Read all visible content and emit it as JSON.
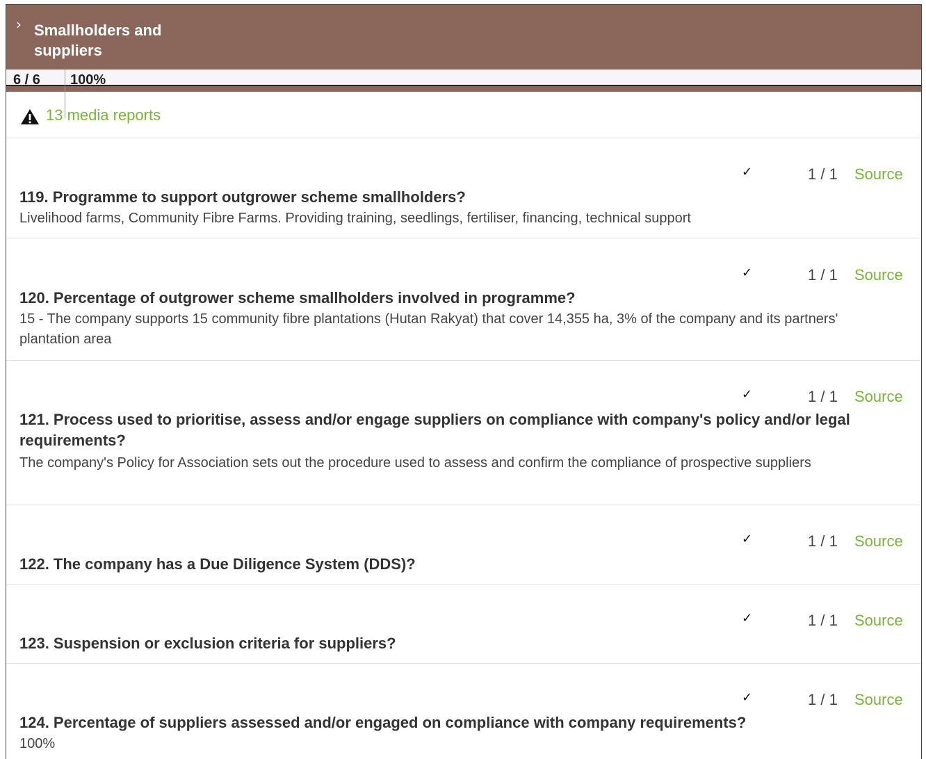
{
  "section": {
    "title": "Smallholders and suppliers",
    "count": "6 / 6",
    "percent": "100%"
  },
  "media": {
    "label": "13 media reports"
  },
  "indicators": [
    {
      "question": "119. Programme to support outgrower scheme smallholders?",
      "answer": "Livelihood farms, Community Fibre Farms. Providing training, seedlings, fertiliser, financing, technical support",
      "check": "✓",
      "score": "1 / 1",
      "source": "Source"
    },
    {
      "question": "120. Percentage of outgrower scheme smallholders involved in programme?",
      "answer": "15 - The company supports 15 community fibre plantations (Hutan Rakyat) that cover 14,355 ha, 3% of the company and its partners' plantation area",
      "check": "✓",
      "score": "1 / 1",
      "source": "Source"
    },
    {
      "question": "121. Process used to prioritise, assess and/or engage suppliers on compliance with company's policy and/or legal requirements?",
      "answer": "The company's Policy for Association sets out the procedure used to assess and confirm the compliance of prospective suppliers",
      "check": "✓",
      "score": "1 / 1",
      "source": "Source"
    },
    {
      "question": "122. The company has a Due Diligence System (DDS)?",
      "answer": "",
      "check": "✓",
      "score": "1 / 1",
      "source": "Source"
    },
    {
      "question": "123. Suspension or exclusion criteria for suppliers?",
      "answer": "",
      "check": "✓",
      "score": "1 / 1",
      "source": "Source"
    },
    {
      "question": "124. Percentage of suppliers assessed and/or engaged on compliance with company requirements?",
      "answer": "100%",
      "check": "✓",
      "score": "1 / 1",
      "source": "Source"
    }
  ]
}
